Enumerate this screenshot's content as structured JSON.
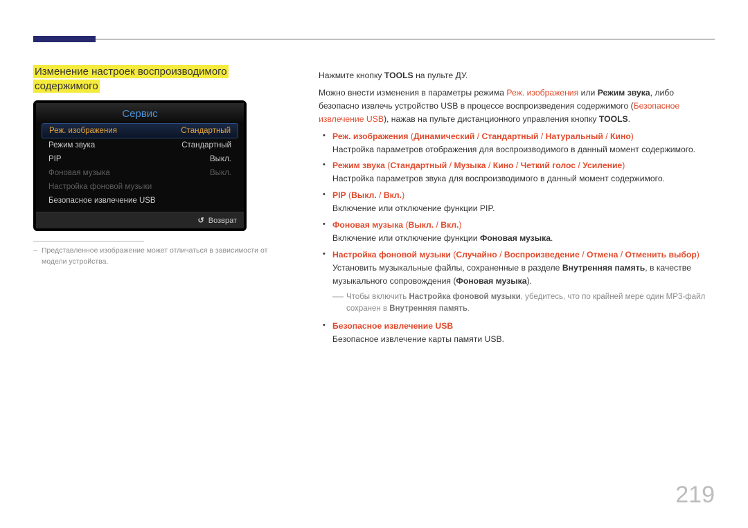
{
  "page_number": "219",
  "section_title_line1": "Изменение настроек воспроизводимого",
  "section_title_line2": "содержимого",
  "osd": {
    "title": "Сервис",
    "rows": [
      {
        "label": "Реж. изображения",
        "value": "Стандартный",
        "state": "sel"
      },
      {
        "label": "Режим звука",
        "value": "Стандартный",
        "state": ""
      },
      {
        "label": "PIP",
        "value": "Выкл.",
        "state": ""
      },
      {
        "label": "Фоновая музыка",
        "value": "Выкл.",
        "state": "dim"
      },
      {
        "label": "Настройка фоновой музыки",
        "value": "",
        "state": "dim"
      },
      {
        "label": "Безопасное извлечение USB",
        "value": "",
        "state": ""
      }
    ],
    "return": "Возврат"
  },
  "footnote": "Представленное изображение может отличаться в зависимости от модели устройства.",
  "body": {
    "intro": {
      "p1_a": "Нажмите кнопку ",
      "p1_b": "TOOLS",
      "p1_c": " на пульте ДУ.",
      "p2_a": "Можно внести изменения в параметры режима ",
      "p2_b": "Реж. изображения",
      "p2_c": " или ",
      "p2_d": "Режим звука",
      "p2_e": ", либо безопасно извлечь устройство USB в процессе воспроизведения содержимого (",
      "p2_f": "Безопасное извлечение USB",
      "p2_g": "), нажав на пульте дистанционного управления кнопку ",
      "p2_h": "TOOLS",
      "p2_i": "."
    },
    "items": {
      "i1": {
        "name": "Реж. изображения",
        "opts": [
          "Динамический",
          "Стандартный",
          "Натуральный",
          "Кино"
        ],
        "desc": "Настройка параметров отображения для воспроизводимого в данный момент содержимого."
      },
      "i2": {
        "name": "Режим звука",
        "opts": [
          "Стандартный",
          "Музыка",
          "Кино",
          "Четкий голос",
          "Усиление"
        ],
        "desc": "Настройка параметров звука для воспроизводимого в данный момент содержимого."
      },
      "i3": {
        "name": "PIP",
        "opts": [
          "Выкл.",
          "Вкл."
        ],
        "desc": "Включение или отключение функции PIP."
      },
      "i4": {
        "name": "Фоновая музыка",
        "opts": [
          "Выкл.",
          "Вкл."
        ],
        "desc_a": "Включение или отключение функции ",
        "desc_b": "Фоновая музыка",
        "desc_c": "."
      },
      "i5": {
        "name": "Настройка фоновой музыки",
        "opts": [
          "Случайно",
          "Воспроизведение",
          "Отмена",
          "Отменить выбор"
        ],
        "desc_a": "Установить музыкальные файлы, сохраненные в разделе ",
        "desc_b": "Внутренняя память",
        "desc_c": ", в качестве музыкального сопровождения (",
        "desc_d": "Фоновая музыка",
        "desc_e": ")."
      },
      "note": {
        "a": "Чтобы включить ",
        "b": "Настройка фоновой музыки",
        "c": ", убедитесь, что по крайней мере один MP3-файл сохранен в ",
        "d": "Внутренняя память",
        "e": "."
      },
      "i6": {
        "name": "Безопасное извлечение USB",
        "desc": "Безопасное извлечение карты памяти USB."
      }
    },
    "sep": " / ",
    "paren_open": " (",
    "paren_close": ")"
  }
}
